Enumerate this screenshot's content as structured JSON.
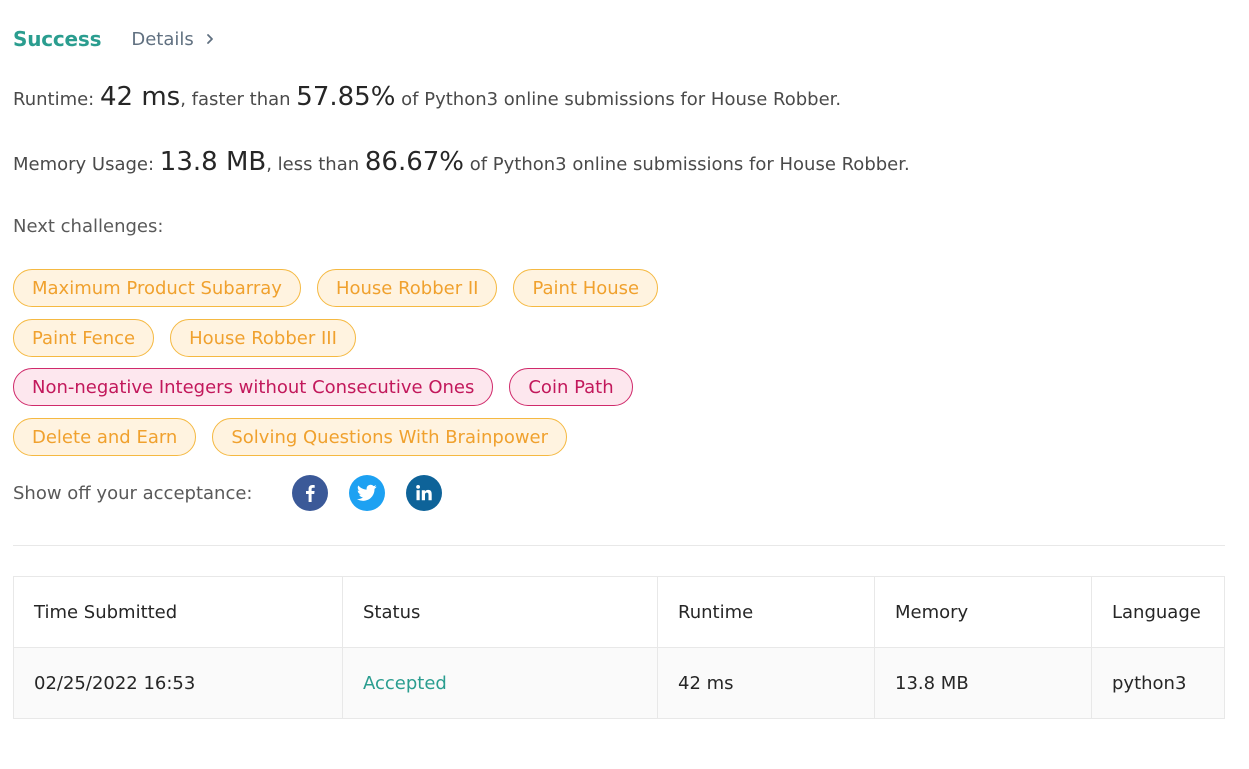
{
  "header": {
    "status": "Success",
    "details_label": "Details"
  },
  "runtime": {
    "prefix": "Runtime: ",
    "value": "42 ms",
    "middle": ", faster than ",
    "percent": "57.85%",
    "suffix": " of Python3 online submissions for House Robber."
  },
  "memory": {
    "prefix": "Memory Usage: ",
    "value": "13.8 MB",
    "middle": ", less than ",
    "percent": "86.67%",
    "suffix": " of Python3 online submissions for House Robber."
  },
  "next_challenges": {
    "label": "Next challenges:",
    "rows": [
      [
        {
          "label": "Maximum Product Subarray",
          "difficulty": "medium"
        },
        {
          "label": "House Robber II",
          "difficulty": "medium"
        },
        {
          "label": "Paint House",
          "difficulty": "medium"
        }
      ],
      [
        {
          "label": "Paint Fence",
          "difficulty": "medium"
        },
        {
          "label": "House Robber III",
          "difficulty": "medium"
        }
      ],
      [
        {
          "label": "Non-negative Integers without Consecutive Ones",
          "difficulty": "hard"
        },
        {
          "label": "Coin Path",
          "difficulty": "hard"
        }
      ],
      [
        {
          "label": "Delete and Earn",
          "difficulty": "medium"
        },
        {
          "label": "Solving Questions With Brainpower",
          "difficulty": "medium"
        }
      ]
    ]
  },
  "share": {
    "label": "Show off your acceptance:",
    "icons": [
      "facebook-icon",
      "twitter-icon",
      "linkedin-icon"
    ]
  },
  "table": {
    "headers": [
      "Time Submitted",
      "Status",
      "Runtime",
      "Memory",
      "Language"
    ],
    "rows": [
      [
        "02/25/2022 16:53",
        "Accepted",
        "42 ms",
        "13.8 MB",
        "python3"
      ]
    ]
  },
  "colors": {
    "success": "#2a9d8f",
    "medium_tag_text": "#f0a12e",
    "medium_tag_border": "#f5b942",
    "hard_tag_text": "#c2185b",
    "hard_tag_border": "#d02a6b",
    "facebook": "#3b5998",
    "twitter": "#1da1f2",
    "linkedin": "#0e6399"
  }
}
